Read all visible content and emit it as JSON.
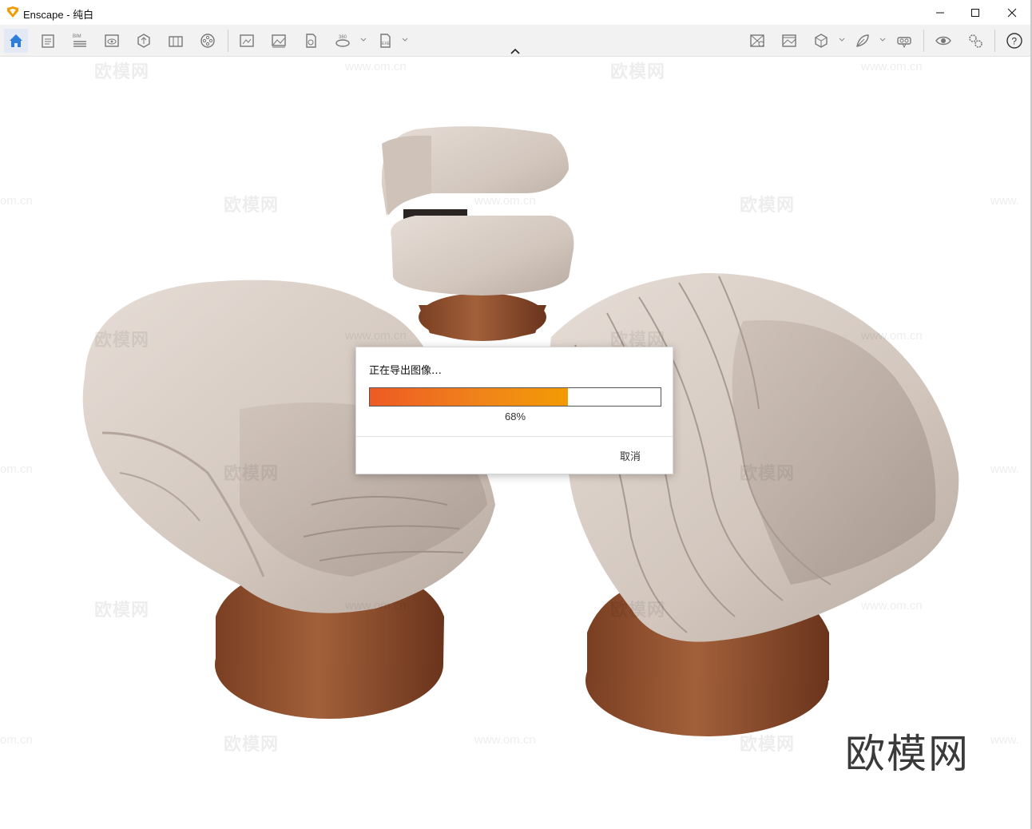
{
  "window": {
    "title": "Enscape - 纯白"
  },
  "toolbar": {
    "left_icons": [
      "home-icon",
      "notes-icon",
      "bim-icon",
      "views-icon",
      "asset-library-icon",
      "material-editor-icon",
      "video-editor-icon",
      "screenshot-icon",
      "batch-render-icon",
      "web-export-icon",
      "panorama-360-icon",
      "exe-export-icon"
    ],
    "bim_label": "BIM",
    "pano_label": "360",
    "exe_label": "EXE",
    "right_icons": [
      "map-icon",
      "image-settings-icon",
      "view-cube-icon",
      "vegetation-icon",
      "vr-headset-icon",
      "visibility-icon",
      "settings-icon",
      "help-icon"
    ]
  },
  "dialog": {
    "title": "正在导出图像…",
    "progress_percent": 68,
    "progress_label": "68%",
    "cancel_label": "取消"
  },
  "watermarks": {
    "brand": "欧模网",
    "url": "www.om.cn",
    "url_partial": "om.cn",
    "url_partial_right": "www."
  },
  "colors": {
    "progress_start": "#ee5a24",
    "progress_end": "#f29b05",
    "home_active": "#2f7fd8",
    "logo": "#f29b05"
  }
}
